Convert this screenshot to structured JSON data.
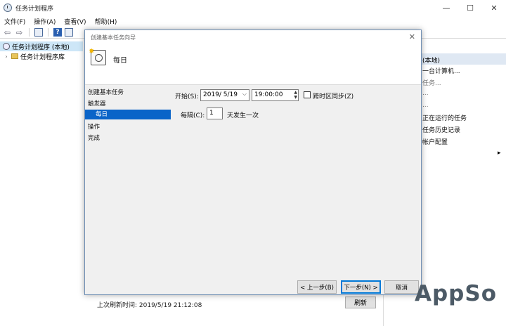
{
  "window": {
    "title": "任务计划程序",
    "minimize": "—",
    "maximize": "☐",
    "close": "✕"
  },
  "menu": [
    "文件(F)",
    "操作(A)",
    "查看(V)",
    "帮助(H)"
  ],
  "toolbar": {
    "back": "⇦",
    "forward": "⇨",
    "help": "?"
  },
  "tree": {
    "root": "任务计划程序 (本地)",
    "child": "任务计划程序库",
    "expander": "›"
  },
  "actions_pane": {
    "header": "(本地)",
    "items": [
      "一台计算机...",
      "任务...",
      "...",
      "...",
      "正在运行的任务",
      "任务历史记录",
      "帐户配置"
    ],
    "more_arrow": "▸"
  },
  "status": {
    "last_refresh": "上次刷新时间: 2019/5/19 21:12:08",
    "refresh_button": "刷新"
  },
  "dialog": {
    "title": "创建基本任务向导",
    "close": "✕",
    "heading": "每日",
    "steps": [
      "创建基本任务",
      "触发器",
      "每日",
      "操作",
      "完成"
    ],
    "start_label": "开始(S):",
    "start_date": "2019/  5/19",
    "date_dropdown": "⌵",
    "start_time": "19:00:00",
    "spin_up": "▲",
    "spin_down": "▼",
    "sync_label": "跨时区同步(Z)",
    "interval_label": "每隔(C):",
    "interval_value": "1",
    "interval_unit": "天发生一次",
    "back_button": "< 上一步(B)",
    "next_button": "下一步(N) >",
    "cancel_button": "取消"
  },
  "watermark": "AppSo"
}
